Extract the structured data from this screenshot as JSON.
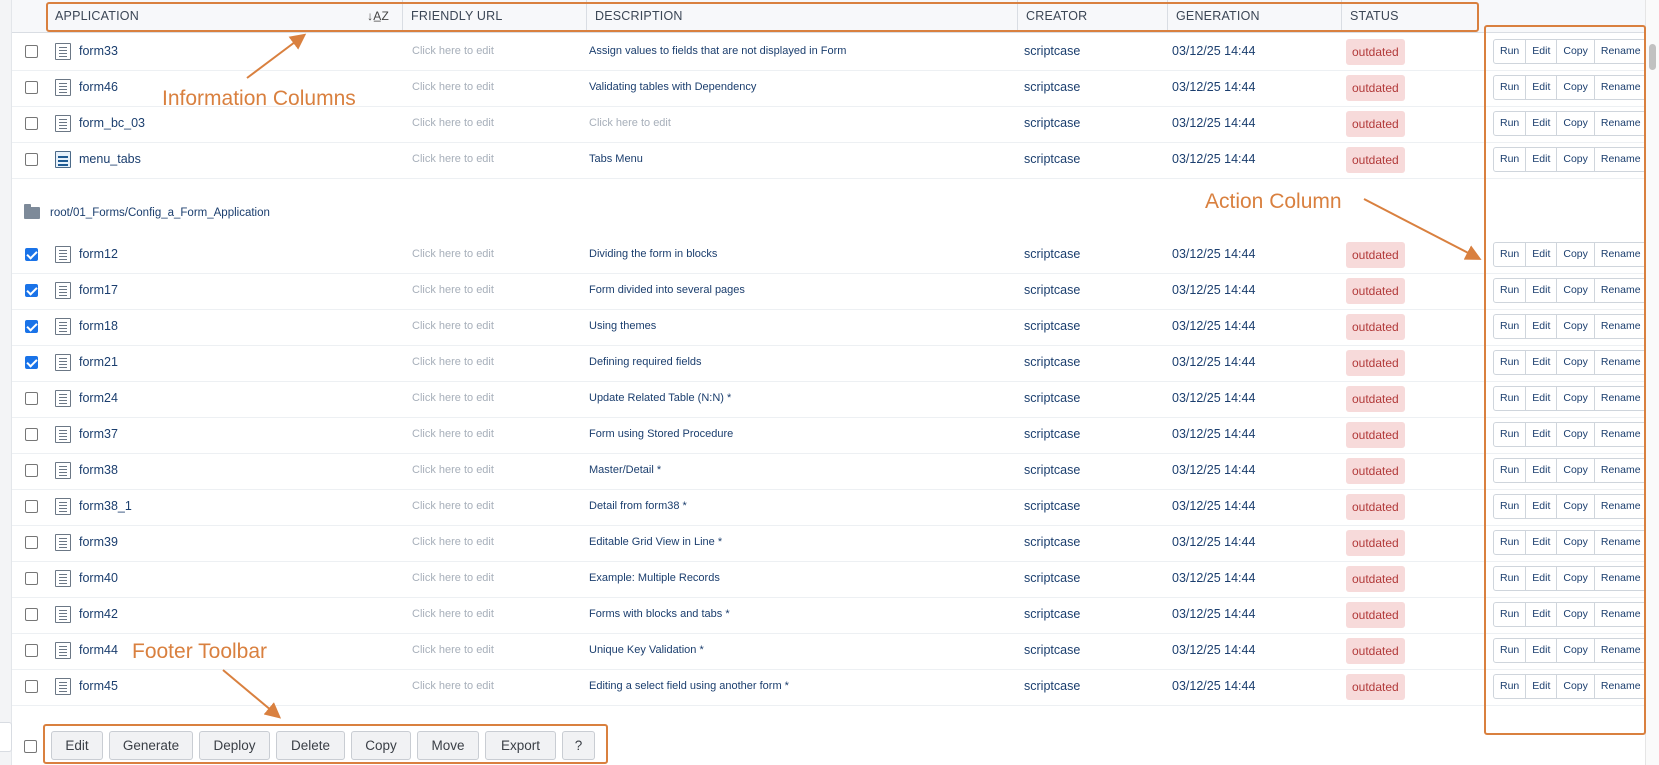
{
  "header": {
    "columns": [
      "APPLICATION",
      "FRIENDLY URL",
      "DESCRIPTION",
      "CREATOR",
      "GENERATION",
      "STATUS"
    ],
    "sort_icon": "sort-alpha-icon"
  },
  "actions": {
    "run": "Run",
    "edit": "Edit",
    "copy": "Copy",
    "rename": "Rename"
  },
  "group1": [
    {
      "name": "form33",
      "friendly": "Click here to edit",
      "desc": "Assign values to fields that are not displayed in Form",
      "creator": "scriptcase",
      "gen": "03/12/25 14:44",
      "status": "outdated",
      "checked": false,
      "icon": "form-icon"
    },
    {
      "name": "form46",
      "friendly": "Click here to edit",
      "desc": "Validating tables with Dependency",
      "creator": "scriptcase",
      "gen": "03/12/25 14:44",
      "status": "outdated",
      "checked": false,
      "icon": "form-icon"
    },
    {
      "name": "form_bc_03",
      "friendly": "Click here to edit",
      "desc": "Click here to edit",
      "creator": "scriptcase",
      "gen": "03/12/25 14:44",
      "status": "outdated",
      "checked": false,
      "icon": "form-icon",
      "desc_placeholder": true
    },
    {
      "name": "menu_tabs",
      "friendly": "Click here to edit",
      "desc": "Tabs Menu",
      "creator": "scriptcase",
      "gen": "03/12/25 14:44",
      "status": "outdated",
      "checked": false,
      "icon": "menu-icon"
    }
  ],
  "folder": {
    "label": "root/01_Forms/Config_a_Form_Application"
  },
  "group2": [
    {
      "name": "form12",
      "friendly": "Click here to edit",
      "desc": "Dividing the form in blocks",
      "creator": "scriptcase",
      "gen": "03/12/25 14:44",
      "status": "outdated",
      "checked": true
    },
    {
      "name": "form17",
      "friendly": "Click here to edit",
      "desc": "Form divided into several pages",
      "creator": "scriptcase",
      "gen": "03/12/25 14:44",
      "status": "outdated",
      "checked": true
    },
    {
      "name": "form18",
      "friendly": "Click here to edit",
      "desc": "Using themes",
      "creator": "scriptcase",
      "gen": "03/12/25 14:44",
      "status": "outdated",
      "checked": true
    },
    {
      "name": "form21",
      "friendly": "Click here to edit",
      "desc": "Defining required fields",
      "creator": "scriptcase",
      "gen": "03/12/25 14:44",
      "status": "outdated",
      "checked": true
    },
    {
      "name": "form24",
      "friendly": "Click here to edit",
      "desc": "Update Related Table (N:N) *",
      "creator": "scriptcase",
      "gen": "03/12/25 14:44",
      "status": "outdated",
      "checked": false
    },
    {
      "name": "form37",
      "friendly": "Click here to edit",
      "desc": "Form using Stored Procedure",
      "creator": "scriptcase",
      "gen": "03/12/25 14:44",
      "status": "outdated",
      "checked": false
    },
    {
      "name": "form38",
      "friendly": "Click here to edit",
      "desc": "Master/Detail *",
      "creator": "scriptcase",
      "gen": "03/12/25 14:44",
      "status": "outdated",
      "checked": false
    },
    {
      "name": "form38_1",
      "friendly": "Click here to edit",
      "desc": "Detail from form38 *",
      "creator": "scriptcase",
      "gen": "03/12/25 14:44",
      "status": "outdated",
      "checked": false
    },
    {
      "name": "form39",
      "friendly": "Click here to edit",
      "desc": "Editable Grid View in Line *",
      "creator": "scriptcase",
      "gen": "03/12/25 14:44",
      "status": "outdated",
      "checked": false
    },
    {
      "name": "form40",
      "friendly": "Click here to edit",
      "desc": "Example: Multiple Records",
      "creator": "scriptcase",
      "gen": "03/12/25 14:44",
      "status": "outdated",
      "checked": false
    },
    {
      "name": "form42",
      "friendly": "Click here to edit",
      "desc": "Forms with blocks and tabs *",
      "creator": "scriptcase",
      "gen": "03/12/25 14:44",
      "status": "outdated",
      "checked": false
    },
    {
      "name": "form44",
      "friendly": "Click here to edit",
      "desc": "Unique Key Validation *",
      "creator": "scriptcase",
      "gen": "03/12/25 14:44",
      "status": "outdated",
      "checked": false
    },
    {
      "name": "form45",
      "friendly": "Click here to edit",
      "desc": "Editing a select field using another form *",
      "creator": "scriptcase",
      "gen": "03/12/25 14:44",
      "status": "outdated",
      "checked": false
    }
  ],
  "footer": {
    "buttons": [
      "Edit",
      "Generate",
      "Deploy",
      "Delete",
      "Copy",
      "Move",
      "Export",
      "?"
    ]
  },
  "annotations": {
    "info_columns": "Information Columns",
    "action_column": "Action Column",
    "footer_toolbar": "Footer Toolbar",
    "color": "#d9803f"
  },
  "colors": {
    "status_bg": "#f7dada",
    "status_text": "#b23a3a",
    "link": "#1b3e6e",
    "placeholder": "#a7afba"
  }
}
